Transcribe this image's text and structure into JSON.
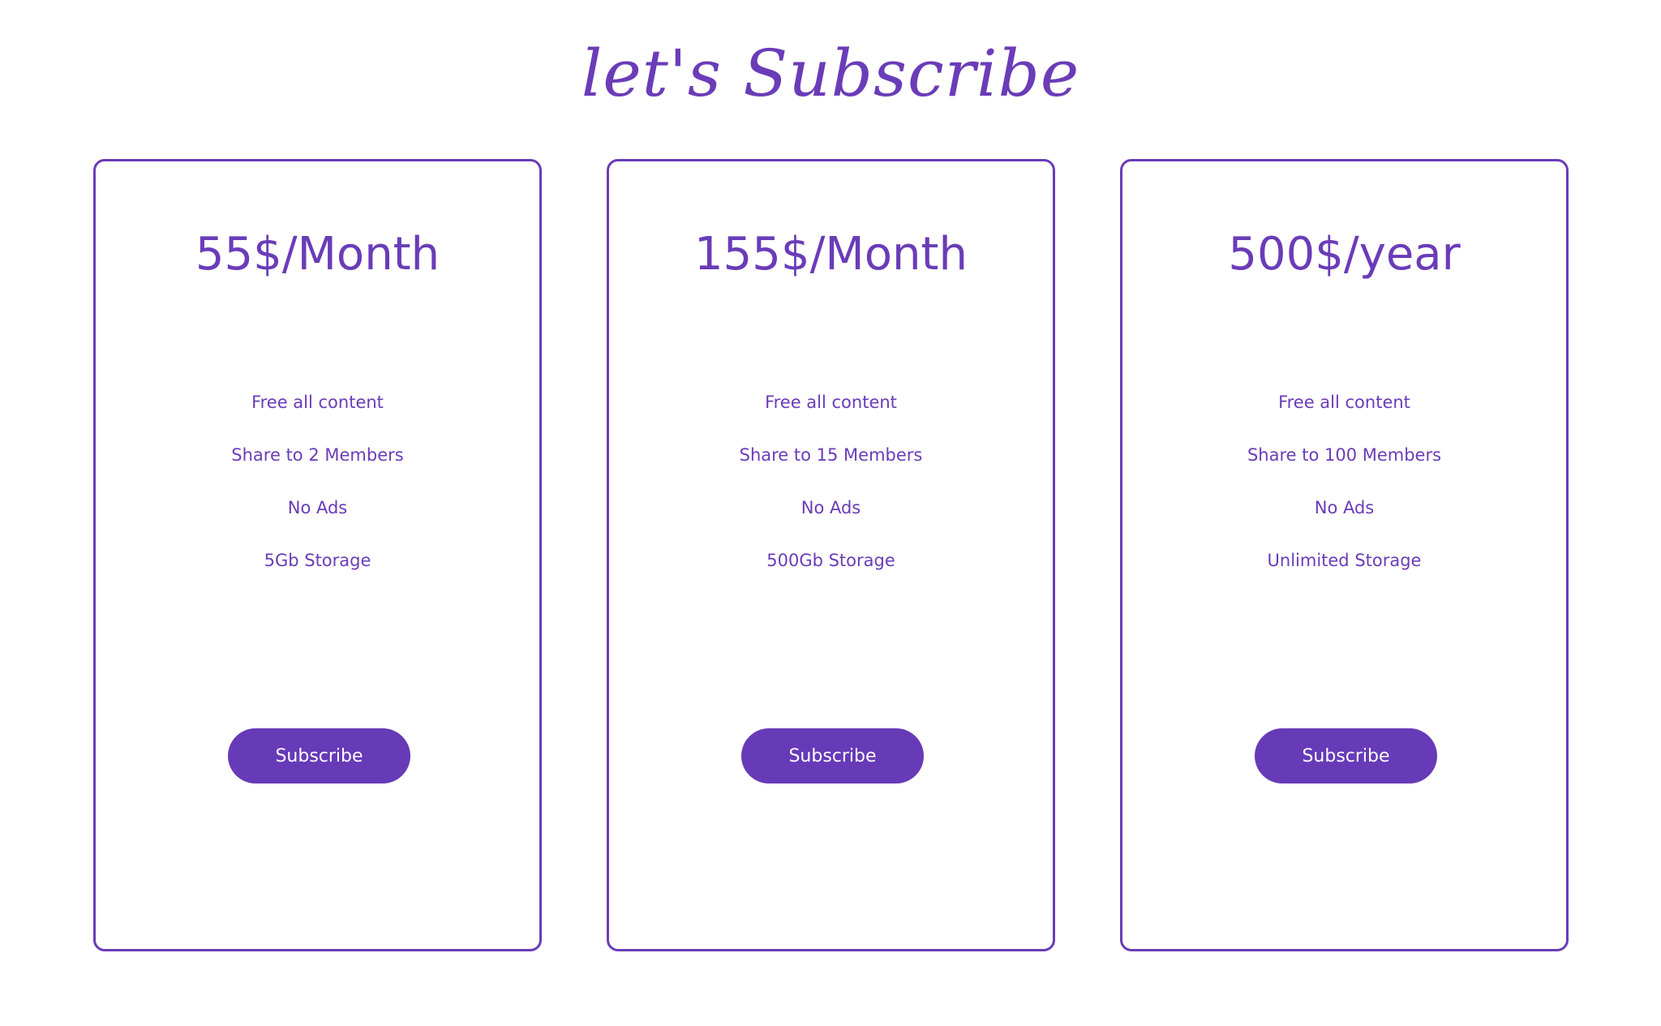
{
  "header": {
    "title": "let's Subscribe"
  },
  "plans": [
    {
      "price": "55$/Month",
      "features": [
        "Free all content",
        "Share to 2 Members",
        "No Ads",
        "5Gb Storage"
      ],
      "button_label": "Subscribe"
    },
    {
      "price": "155$/Month",
      "features": [
        "Free all content",
        "Share to 15 Members",
        "No Ads",
        "500Gb Storage"
      ],
      "button_label": "Subscribe"
    },
    {
      "price": "500$/year",
      "features": [
        "Free all content",
        "Share to 100 Members",
        "No Ads",
        "Unlimited Storage"
      ],
      "button_label": "Subscribe"
    }
  ],
  "colors": {
    "accent": "#673ab7",
    "background": "#ffffff",
    "button_text": "#ffffff"
  }
}
